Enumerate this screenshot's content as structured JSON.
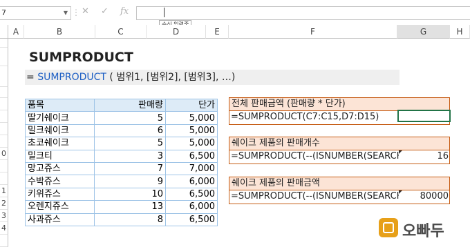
{
  "formula_bar": {
    "name_box": "7",
    "cancel_icon": "✕",
    "confirm_icon": "✓",
    "fx_label": "fx",
    "tooltip": "수식 입력줄"
  },
  "columns": [
    "A",
    "B",
    "C",
    "D",
    "E",
    "F",
    "G",
    "H"
  ],
  "rows": [
    "",
    "",
    "",
    "",
    "",
    "",
    "",
    "",
    "",
    "",
    "",
    "",
    "",
    "",
    "",
    "",
    "0",
    "1",
    "2",
    "3",
    "4",
    ""
  ],
  "sheet": {
    "title": "SUMPRODUCT",
    "syntax_prefix": "= ",
    "syntax_func": "SUMPRODUCT",
    "syntax_args": " ( 범위1, [범위2], [범위3], …)"
  },
  "table": {
    "headers": [
      "품목",
      "판매량",
      "단가"
    ],
    "rows": [
      [
        "딸기쉐이크",
        "5",
        "5,000"
      ],
      [
        "밀크쉐이크",
        "6",
        "5,000"
      ],
      [
        "초코쉐이크",
        "5",
        "5,000"
      ],
      [
        "밀크티",
        "3",
        "6,500"
      ],
      [
        "망고쥬스",
        "7",
        "7,000"
      ],
      [
        "수박쥬스",
        "9",
        "6,000"
      ],
      [
        "키위쥬스",
        "10",
        "6,500"
      ],
      [
        "오렌지쥬스",
        "13",
        "6,000"
      ],
      [
        "사과쥬스",
        "8",
        "6,500"
      ]
    ]
  },
  "boxes": [
    {
      "title": "전체 판매금액 (판매량 * 단가)",
      "formula": "=SUMPRODUCT(C7:C15,D7:D15)",
      "result": ""
    },
    {
      "title": "쉐이크 제품의 판매개수",
      "formula": "=SUMPRODUCT(--(ISNUMBER(SEARCH",
      "result": "16"
    },
    {
      "title": "쉐이크 제품의 판매금액",
      "formula": "=SUMPRODUCT(--(ISNUMBER(SEARCH",
      "result": "80000"
    }
  ],
  "logo": {
    "text": "오빠두"
  }
}
